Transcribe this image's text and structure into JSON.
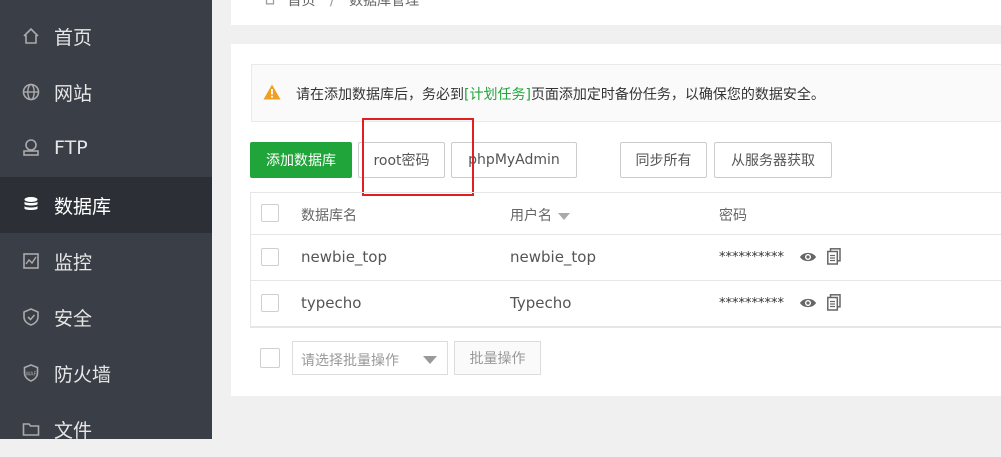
{
  "sidebar": {
    "items": [
      {
        "label": "首页",
        "icon": "home-icon"
      },
      {
        "label": "网站",
        "icon": "globe-icon"
      },
      {
        "label": "FTP",
        "icon": "ftp-icon"
      },
      {
        "label": "数据库",
        "icon": "database-icon",
        "active": true
      },
      {
        "label": "监控",
        "icon": "monitor-icon"
      },
      {
        "label": "安全",
        "icon": "shield-icon"
      },
      {
        "label": "防火墙",
        "icon": "firewall-icon"
      },
      {
        "label": "文件",
        "icon": "folder-icon"
      }
    ]
  },
  "breadcrumb": {
    "home": "首页",
    "separator": "/",
    "current": "数据库管理"
  },
  "alert": {
    "before": "请在添加数据库后，务必到",
    "link": "[计划任务]",
    "after": "页面添加定时备份任务，以确保您的数据安全。"
  },
  "toolbar": {
    "add": "添加数据库",
    "root": "root密码",
    "phpmyadmin": "phpMyAdmin",
    "sync_all": "同步所有",
    "fetch_from_server": "从服务器获取"
  },
  "table": {
    "headers": [
      "数据库名",
      "用户名",
      "密码"
    ],
    "rows": [
      {
        "name": "newbie_top",
        "user": "newbie_top",
        "password": "**********"
      },
      {
        "name": "typecho",
        "user": "Typecho",
        "password": "**********"
      }
    ]
  },
  "batch": {
    "placeholder": "请选择批量操作",
    "button": "批量操作"
  },
  "colors": {
    "accent": "#20a53a",
    "sidebar": "#3a3f47",
    "highlight": "#e02020",
    "warning": "#f0a020"
  }
}
